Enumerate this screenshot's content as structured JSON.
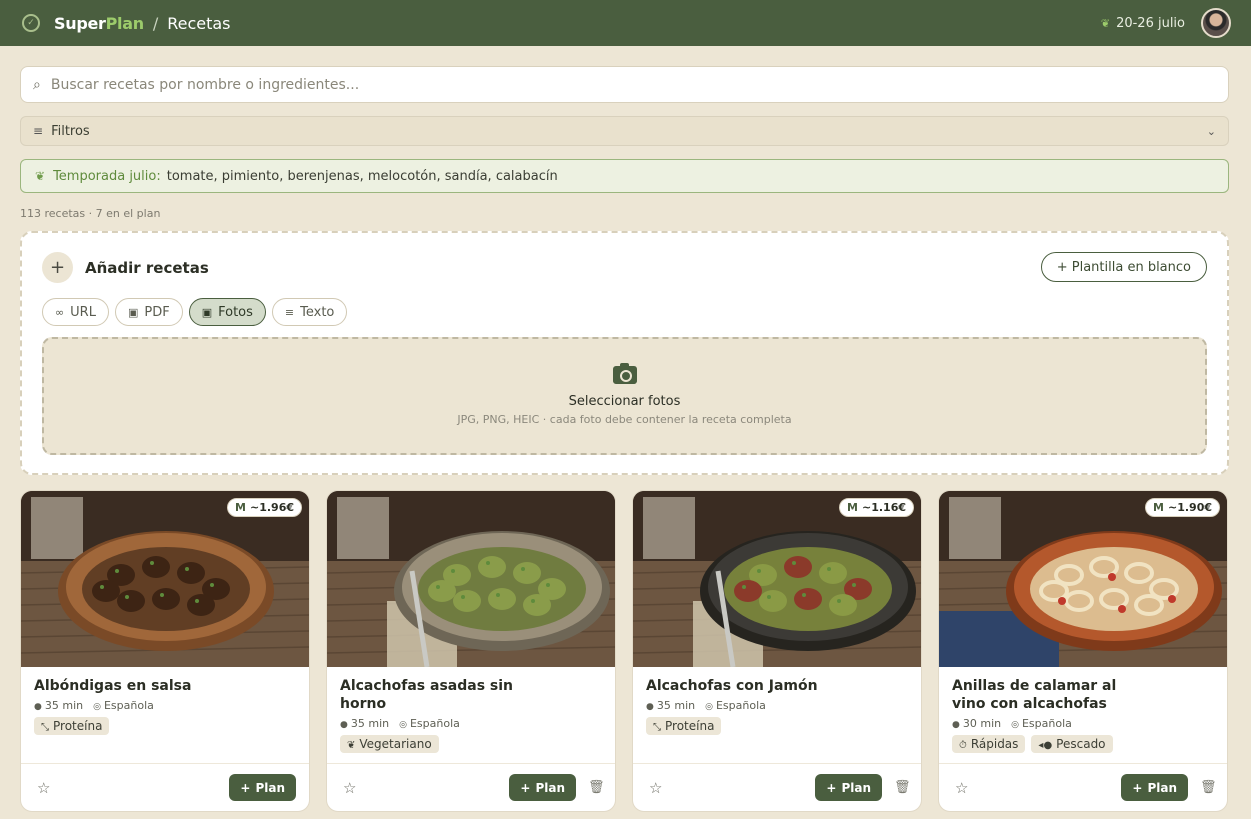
{
  "header": {
    "brand_a": "Super",
    "brand_b": "Plan",
    "separator": "/",
    "crumb": "Recetas",
    "week": "20-26 julio"
  },
  "search": {
    "placeholder": "Buscar recetas por nombre o ingredientes..."
  },
  "filters": {
    "label": "Filtros"
  },
  "season": {
    "label": "Temporada julio:",
    "items": "tomate, pimiento, berenjenas, melocotón, sandía, calabacín"
  },
  "counts": "113 recetas · 7 en el plan",
  "add": {
    "plus": "+",
    "title": "Añadir recetas",
    "blank_button": "+ Plantilla en blanco",
    "tabs": [
      {
        "label": "URL",
        "icon": "link-icon",
        "glyph": "∞"
      },
      {
        "label": "PDF",
        "icon": "pdf-icon",
        "glyph": "▣"
      },
      {
        "label": "Fotos",
        "icon": "image-icon",
        "glyph": "▣"
      },
      {
        "label": "Texto",
        "icon": "text-icon",
        "glyph": "≡"
      }
    ],
    "active_tab": "Fotos",
    "drop_title": "Seleccionar fotos",
    "drop_hint": "JPG, PNG, HEIC · cada foto debe contener la receta completa"
  },
  "cards": [
    {
      "title": "Albóndigas en salsa",
      "price_prefix": "M",
      "price": "~1.96€",
      "time": "35 min",
      "cuisine": "Española",
      "tags": [
        {
          "label": "Proteína",
          "icon": "arrows-icon",
          "glyph": "⤡"
        }
      ],
      "plan_label": "Plan",
      "deletable": false
    },
    {
      "title": "Alcachofas asadas sin horno",
      "price_prefix": "",
      "price": "",
      "time": "35 min",
      "cuisine": "Española",
      "tags": [
        {
          "label": "Vegetariano",
          "icon": "leaf-icon",
          "glyph": "❦"
        }
      ],
      "plan_label": "Plan",
      "deletable": true
    },
    {
      "title": "Alcachofas con Jamón",
      "price_prefix": "M",
      "price": "~1.16€",
      "time": "35 min",
      "cuisine": "Española",
      "tags": [
        {
          "label": "Proteína",
          "icon": "arrows-icon",
          "glyph": "⤡"
        }
      ],
      "plan_label": "Plan",
      "deletable": true
    },
    {
      "title": "Anillas de calamar al vino con alcachofas",
      "price_prefix": "M",
      "price": "~1.90€",
      "time": "30 min",
      "cuisine": "Española",
      "tags": [
        {
          "label": "Rápidas",
          "icon": "timer-icon",
          "glyph": "⏱"
        },
        {
          "label": "Pescado",
          "icon": "fish-icon",
          "glyph": "◂●"
        }
      ],
      "plan_label": "Plan",
      "deletable": true
    }
  ],
  "colors": {
    "header": "#4a5e3f",
    "accent_green": "#9ccb6b",
    "background": "#ede6d5"
  }
}
